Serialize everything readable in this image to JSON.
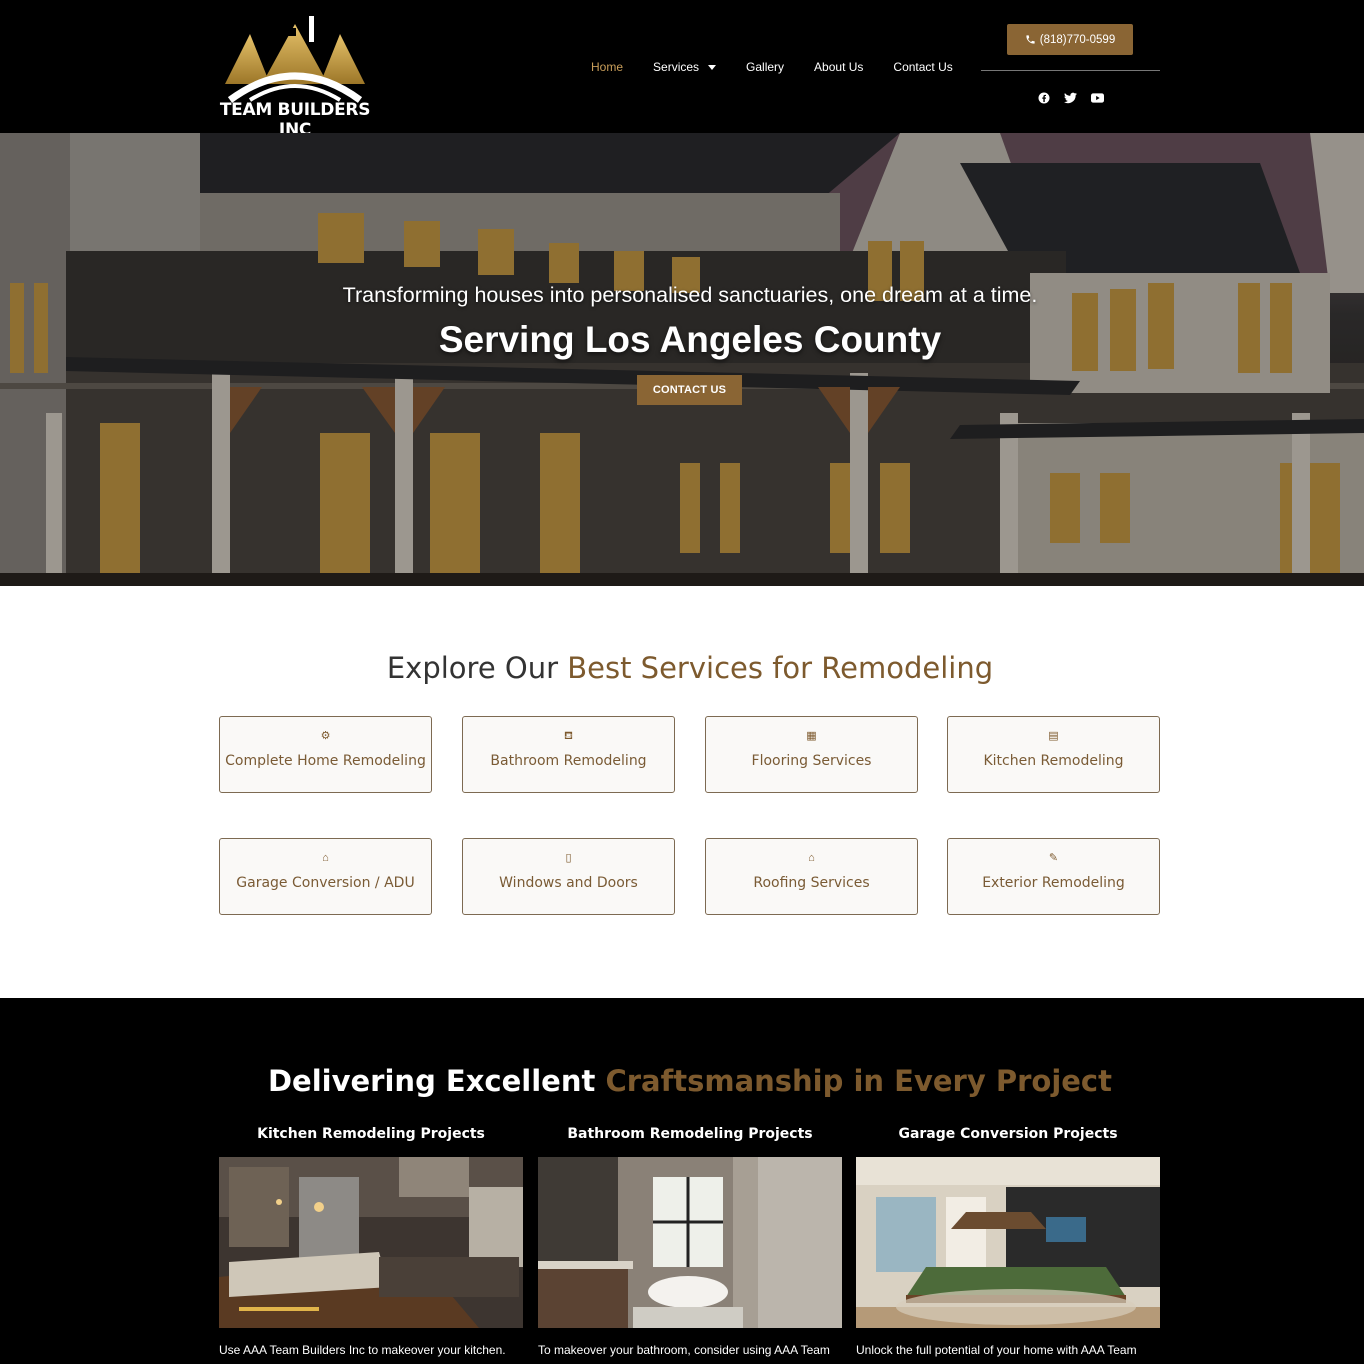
{
  "header": {
    "logo_text": "TEAM BUILDERS INC",
    "nav": [
      {
        "label": "Home",
        "active": true
      },
      {
        "label": "Services",
        "has_dropdown": true
      },
      {
        "label": "Gallery"
      },
      {
        "label": "About Us"
      },
      {
        "label": "Contact Us"
      }
    ],
    "phone": "(818)770-0599",
    "socials": [
      "facebook-icon",
      "twitter-icon",
      "youtube-icon"
    ]
  },
  "hero": {
    "subtitle": "Transforming houses into personalised sanctuaries, one dream at a time.",
    "title": "Serving Los Angeles County",
    "cta": "CONTACT US"
  },
  "services": {
    "title_plain": "Explore Our ",
    "title_accent": "Best Services for Remodeling",
    "items": [
      {
        "label": "Complete Home Remodeling",
        "icon": "house-cog-icon"
      },
      {
        "label": "Bathroom Remodeling",
        "icon": "bathtub-icon"
      },
      {
        "label": "Flooring Services",
        "icon": "floor-tiles-icon"
      },
      {
        "label": "Kitchen Remodeling",
        "icon": "kitchen-icon"
      },
      {
        "label": "Garage Conversion / ADU",
        "icon": "garage-icon"
      },
      {
        "label": "Windows and Doors",
        "icon": "door-window-icon"
      },
      {
        "label": "Roofing Services",
        "icon": "roof-icon"
      },
      {
        "label": "Exterior Remodeling",
        "icon": "exterior-brush-icon"
      }
    ]
  },
  "projects": {
    "title_plain": "Delivering Excellent ",
    "title_accent": "Craftsmanship in Every Project",
    "items": [
      {
        "heading": "Kitchen Remodeling Projects",
        "desc": "Use AAA Team Builders Inc to makeover your kitchen."
      },
      {
        "heading": "Bathroom Remodeling Projects",
        "desc": "To makeover your bathroom, consider using AAA Team"
      },
      {
        "heading": "Garage Conversion Projects",
        "desc": "Unlock the full potential of your home with AAA Team"
      }
    ]
  },
  "colors": {
    "accent": "#8a6534",
    "accent_text": "#7d5a2e",
    "nav_active": "#c99e5a",
    "header_bg": "#000000"
  }
}
